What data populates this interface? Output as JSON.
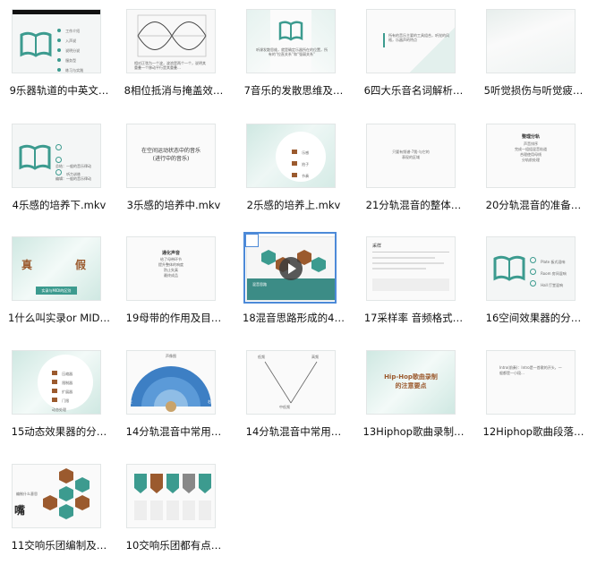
{
  "files": [
    {
      "name": "9乐器轨道的中英文…",
      "thumb_text": [
        "工作介绍",
        "入声说",
        "说明分说",
        "服务型",
        "练习与实践"
      ]
    },
    {
      "name": "8相位抵消与掩盖效…",
      "thumb_text": [
        "相对正弦为一个波，波浪是两个一个，说明其重叠一个移动平行是其重叠…"
      ]
    },
    {
      "name": "7音乐的发散思维及…",
      "thumb_text": [
        "听课发散思维，就是确定乐器所在的位置，所有的“拉直关系”和“强弱关系”"
      ]
    },
    {
      "name": "6四大乐音名词解析…",
      "thumb_text": [
        "所有的音乐主要的工具组合，听觉的风格，乐器声的特点"
      ]
    },
    {
      "name": "5听觉损伤与听觉疲…",
      "thumb_text": []
    },
    {
      "name": "4乐感的培养下.mkv",
      "thumb_text": [
        "总结：一般的音乐律动",
        "编辑：一般的音乐律动",
        "听力训练"
      ]
    },
    {
      "name": "3乐感的培养中.mkv",
      "thumb_text": [
        "在空间运动状态中的音乐",
        "(进行中的音乐)"
      ]
    },
    {
      "name": "2乐感的培养上.mkv",
      "thumb_text": [
        "乐感",
        "拍子",
        "节奏"
      ]
    },
    {
      "name": "21分轨混音的整体…",
      "thumb_text": [
        "只要有频谱-7我-与它的",
        "表现的区域"
      ]
    },
    {
      "name": "20分轨混音的准备…",
      "thumb_text": [
        "整理分轨",
        "声音排序",
        "完成一组组混音轨道",
        "合理使用母线",
        "分轨前处理"
      ]
    },
    {
      "name": "1什么叫实录or MID…",
      "thumb_text": [
        "真",
        "假",
        "实录与MIDI的区别"
      ]
    },
    {
      "name": "19母带的作用及目…",
      "thumb_text": [
        "通化声音",
        "给了母带环节",
        "提升整体的响度",
        "防止失真",
        "最终成品"
      ]
    },
    {
      "name": "18混音思路形成的4…",
      "thumb_text": [
        "混音思路"
      ]
    },
    {
      "name": "17采样率 音频格式…",
      "thumb_text": [
        "采样"
      ]
    },
    {
      "name": "16空间效果器的分…",
      "thumb_text": [
        "Plate 板式混响",
        "Room 房间混响",
        "Hall 厅堂混响"
      ]
    },
    {
      "name": "15动态效果器的分…",
      "thumb_text": [
        "压缩器",
        "限制器",
        "扩展器",
        "门限",
        "动态处理"
      ]
    },
    {
      "name": "14分轨混音中常用…",
      "thumb_text": [
        "声像图",
        "左",
        "右"
      ]
    },
    {
      "name": "14分轨混音中常用…",
      "thumb_text": [
        "低频",
        "高频",
        "中低频"
      ]
    },
    {
      "name": "13Hiphop歌曲录制…",
      "thumb_text": [
        "Hip-Hop歌曲录制",
        "的注意要点"
      ]
    },
    {
      "name": "12Hiphop歌曲段落…",
      "thumb_text": [
        "Intro(前奏)：Intro是一首歌的开头，一般都是一小段…"
      ]
    },
    {
      "name": "11交响乐团编制及…",
      "thumb_text": [
        "编制什么意思",
        "嘴"
      ]
    },
    {
      "name": "10交响乐团都有点…",
      "thumb_text": []
    }
  ],
  "colors": {
    "accent": "#3c9b8f",
    "selection": "#4d8ad8",
    "brown": "#9b5a2e"
  }
}
